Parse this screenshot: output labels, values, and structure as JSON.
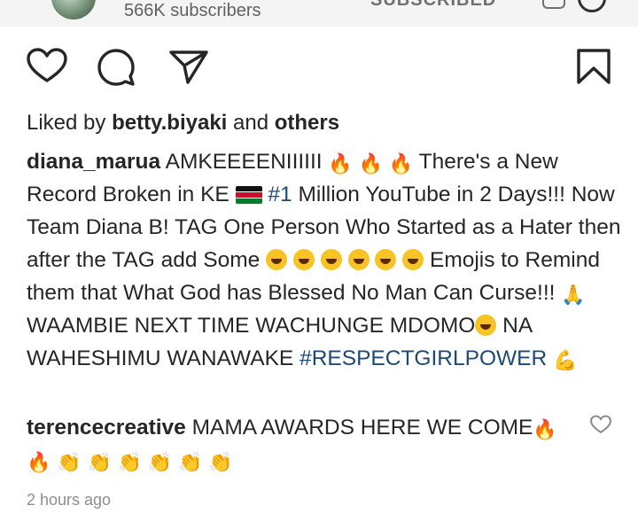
{
  "channel": {
    "subscribers": "566K subscribers",
    "subscribe_label": "SUBSCRIBED"
  },
  "icons": [
    "heart-icon",
    "comment-icon",
    "share-icon",
    "bookmark-icon",
    "bell-icon"
  ],
  "post": {
    "liked_prefix": "Liked by ",
    "liked_user": "betty.biyaki",
    "liked_and": " and ",
    "liked_others": "others",
    "caption_user": "diana_marua",
    "caption_part1": " AMKEEEENIIIIII ",
    "caption_part2": " There's a New Record Broken in KE ",
    "caption_hashtag1": "#1",
    "caption_part3": " Million YouTube in 2 Days!!! Now Team Diana B! TAG One Person Who Started as a Hater then after the TAG add Some ",
    "caption_part4": " Emojis to Remind them that What God has Blessed No Man Can Curse!!! ",
    "caption_part5": " WAAMBIE NEXT TIME WACHUNGE MDOMO",
    "caption_part6": " NA WAHESHIMU WANAWAKE ",
    "caption_hashtag2": "#RESPECTGIRLPOWER"
  },
  "comment": {
    "user": "terencecreative",
    "text": " MAMA AWARDS HERE WE COME"
  },
  "timestamp": "2 hours ago",
  "colors": {
    "text": "#262626",
    "hashtag": "#1b4a78",
    "muted": "#8e8e8e"
  }
}
